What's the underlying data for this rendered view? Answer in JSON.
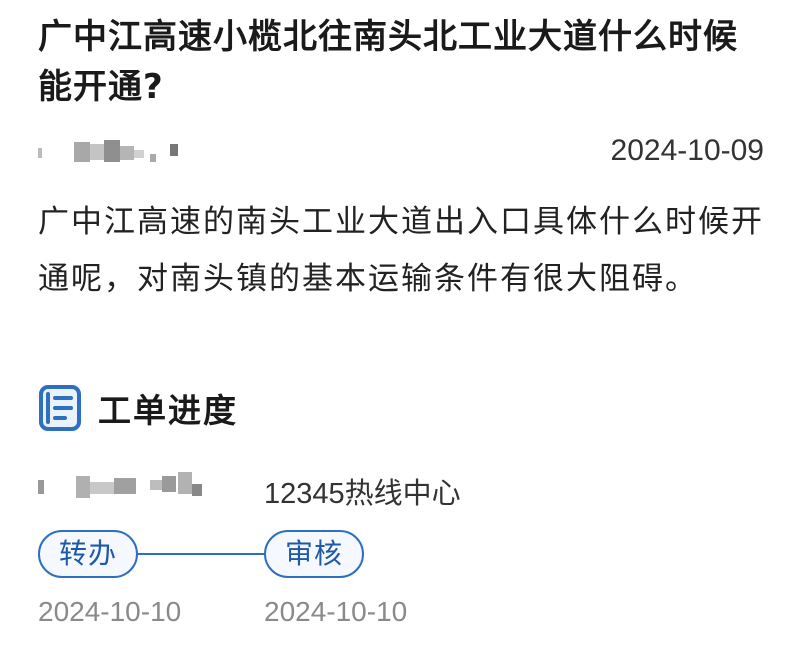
{
  "question": {
    "title": "广中江高速小榄北往南头北工业大道什么时候能开通?",
    "date": "2024-10-09",
    "body": "广中江高速的南头工业大道出入口具体什么时候开通呢，对南头镇的基本运输条件有很大阻碍。"
  },
  "progress": {
    "icon": "document-icon",
    "title": "工单进度",
    "department": "12345热线中心",
    "steps": [
      {
        "label": "转办",
        "date": "2024-10-10"
      },
      {
        "label": "审核",
        "date": "2024-10-10"
      }
    ]
  },
  "colors": {
    "accent": "#2e6fc1",
    "pill_text": "#1f5aa8",
    "date_gray": "#8a8a8a"
  }
}
